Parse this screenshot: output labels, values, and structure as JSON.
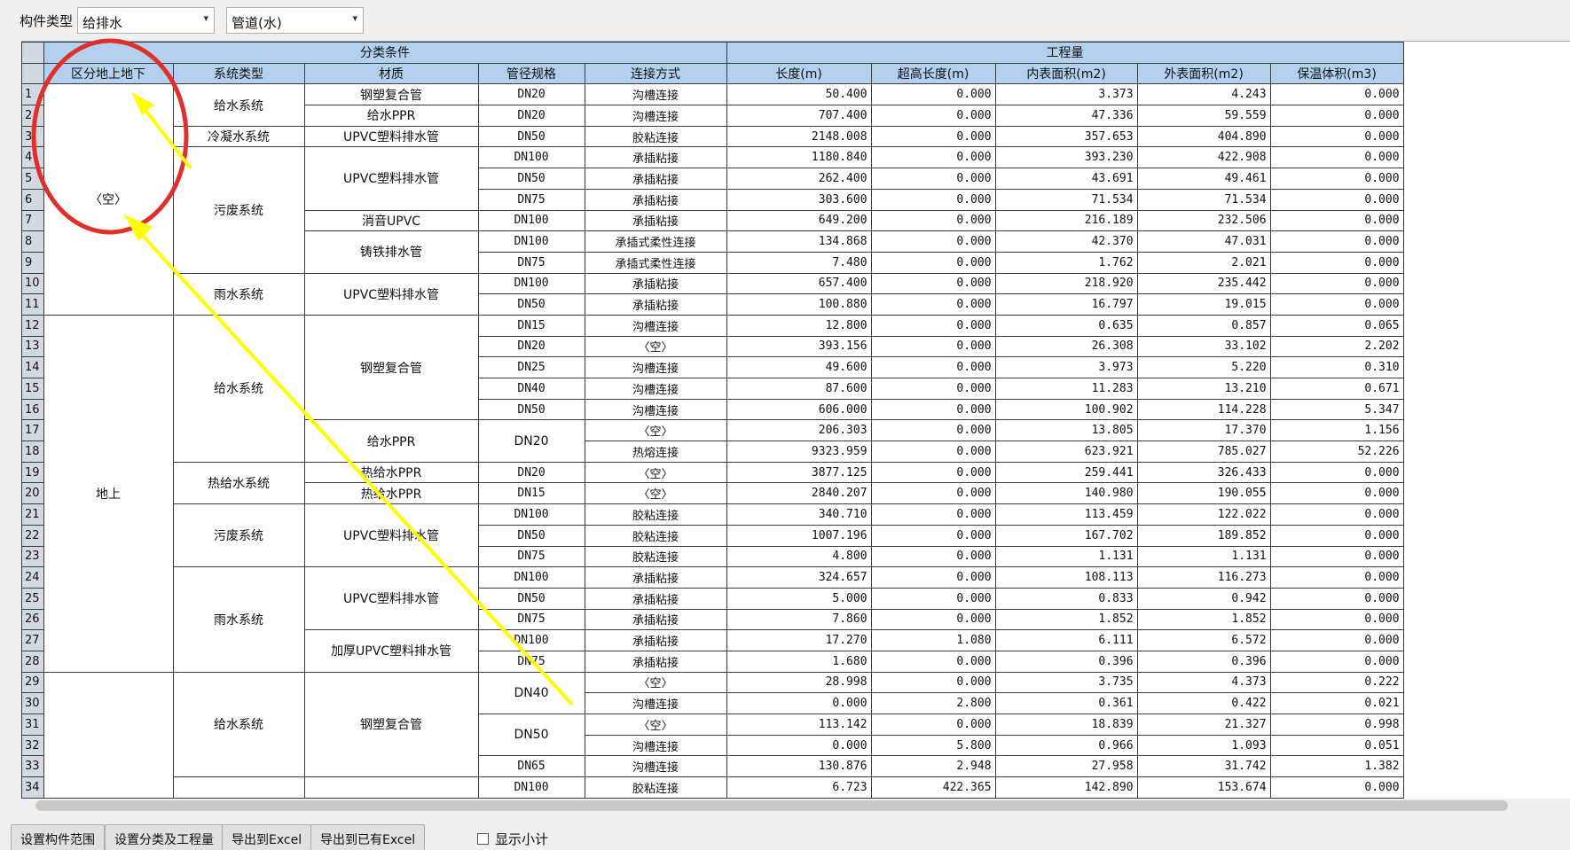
{
  "toolbar": {
    "component_type_label": "构件类型",
    "combo1": "给排水",
    "combo2": "管道(水)"
  },
  "header": {
    "group_classify": "分类条件",
    "group_quantity": "工程量",
    "columns": [
      "区分地上地下",
      "系统类型",
      "材质",
      "管径规格",
      "连接方式",
      "长度(m)",
      "超高长度(m)",
      "内表面积(m2)",
      "外表面积(m2)",
      "保温体积(m3)"
    ]
  },
  "rows": [
    {
      "n": "1",
      "g": "DN20",
      "j": "沟槽连接",
      "v": [
        "50.400",
        "0.000",
        "3.373",
        "4.243",
        "0.000"
      ]
    },
    {
      "n": "2",
      "g": "DN20",
      "j": "沟槽连接",
      "v": [
        "707.400",
        "0.000",
        "47.336",
        "59.559",
        "0.000"
      ]
    },
    {
      "n": "3",
      "g": "DN50",
      "j": "胶粘连接",
      "v": [
        "2148.008",
        "0.000",
        "357.653",
        "404.890",
        "0.000"
      ]
    },
    {
      "n": "4",
      "g": "DN100",
      "j": "承插粘接",
      "v": [
        "1180.840",
        "0.000",
        "393.230",
        "422.908",
        "0.000"
      ]
    },
    {
      "n": "5",
      "g": "DN50",
      "j": "承插粘接",
      "v": [
        "262.400",
        "0.000",
        "43.691",
        "49.461",
        "0.000"
      ]
    },
    {
      "n": "6",
      "g": "DN75",
      "j": "承插粘接",
      "v": [
        "303.600",
        "0.000",
        "71.534",
        "71.534",
        "0.000"
      ]
    },
    {
      "n": "7",
      "g": "DN100",
      "j": "承插粘接",
      "v": [
        "649.200",
        "0.000",
        "216.189",
        "232.506",
        "0.000"
      ]
    },
    {
      "n": "8",
      "g": "DN100",
      "j": "承插式柔性连接",
      "v": [
        "134.868",
        "0.000",
        "42.370",
        "47.031",
        "0.000"
      ]
    },
    {
      "n": "9",
      "g": "DN75",
      "j": "承插式柔性连接",
      "v": [
        "7.480",
        "0.000",
        "1.762",
        "2.021",
        "0.000"
      ]
    },
    {
      "n": "10",
      "g": "DN100",
      "j": "承插粘接",
      "v": [
        "657.400",
        "0.000",
        "218.920",
        "235.442",
        "0.000"
      ]
    },
    {
      "n": "11",
      "g": "DN50",
      "j": "承插粘接",
      "v": [
        "100.880",
        "0.000",
        "16.797",
        "19.015",
        "0.000"
      ]
    },
    {
      "n": "12",
      "g": "DN15",
      "j": "沟槽连接",
      "v": [
        "12.800",
        "0.000",
        "0.635",
        "0.857",
        "0.065"
      ]
    },
    {
      "n": "13",
      "g": "DN20",
      "j": "〈空〉",
      "v": [
        "393.156",
        "0.000",
        "26.308",
        "33.102",
        "2.202"
      ]
    },
    {
      "n": "14",
      "g": "DN25",
      "j": "沟槽连接",
      "v": [
        "49.600",
        "0.000",
        "3.973",
        "5.220",
        "0.310"
      ]
    },
    {
      "n": "15",
      "g": "DN40",
      "j": "沟槽连接",
      "v": [
        "87.600",
        "0.000",
        "11.283",
        "13.210",
        "0.671"
      ]
    },
    {
      "n": "16",
      "g": "DN50",
      "j": "沟槽连接",
      "v": [
        "606.000",
        "0.000",
        "100.902",
        "114.228",
        "5.347"
      ]
    },
    {
      "n": "17",
      "g": "",
      "j": "〈空〉",
      "v": [
        "206.303",
        "0.000",
        "13.805",
        "17.370",
        "1.156"
      ]
    },
    {
      "n": "18",
      "g": "",
      "j": "热熔连接",
      "v": [
        "9323.959",
        "0.000",
        "623.921",
        "785.027",
        "52.226"
      ]
    },
    {
      "n": "19",
      "g": "DN20",
      "j": "〈空〉",
      "v": [
        "3877.125",
        "0.000",
        "259.441",
        "326.433",
        "0.000"
      ]
    },
    {
      "n": "20",
      "g": "DN15",
      "j": "〈空〉",
      "v": [
        "2840.207",
        "0.000",
        "140.980",
        "190.055",
        "0.000"
      ]
    },
    {
      "n": "21",
      "g": "DN100",
      "j": "胶粘连接",
      "v": [
        "340.710",
        "0.000",
        "113.459",
        "122.022",
        "0.000"
      ]
    },
    {
      "n": "22",
      "g": "DN50",
      "j": "胶粘连接",
      "v": [
        "1007.196",
        "0.000",
        "167.702",
        "189.852",
        "0.000"
      ]
    },
    {
      "n": "23",
      "g": "DN75",
      "j": "胶粘连接",
      "v": [
        "4.800",
        "0.000",
        "1.131",
        "1.131",
        "0.000"
      ]
    },
    {
      "n": "24",
      "g": "DN100",
      "j": "承插粘接",
      "v": [
        "324.657",
        "0.000",
        "108.113",
        "116.273",
        "0.000"
      ]
    },
    {
      "n": "25",
      "g": "DN50",
      "j": "承插粘接",
      "v": [
        "5.000",
        "0.000",
        "0.833",
        "0.942",
        "0.000"
      ]
    },
    {
      "n": "26",
      "g": "DN75",
      "j": "承插粘接",
      "v": [
        "7.860",
        "0.000",
        "1.852",
        "1.852",
        "0.000"
      ]
    },
    {
      "n": "27",
      "g": "DN100",
      "j": "承插粘接",
      "v": [
        "17.270",
        "1.080",
        "6.111",
        "6.572",
        "0.000"
      ]
    },
    {
      "n": "28",
      "g": "DN75",
      "j": "承插粘接",
      "v": [
        "1.680",
        "0.000",
        "0.396",
        "0.396",
        "0.000"
      ]
    },
    {
      "n": "29",
      "g": "",
      "j": "〈空〉",
      "v": [
        "28.998",
        "0.000",
        "3.735",
        "4.373",
        "0.222"
      ]
    },
    {
      "n": "30",
      "g": "",
      "j": "沟槽连接",
      "v": [
        "0.000",
        "2.800",
        "0.361",
        "0.422",
        "0.021"
      ]
    },
    {
      "n": "31",
      "g": "",
      "j": "〈空〉",
      "v": [
        "113.142",
        "0.000",
        "18.839",
        "21.327",
        "0.998"
      ]
    },
    {
      "n": "32",
      "g": "",
      "j": "沟槽连接",
      "v": [
        "0.000",
        "5.800",
        "0.966",
        "1.093",
        "0.051"
      ]
    },
    {
      "n": "33",
      "g": "DN65",
      "j": "沟槽连接",
      "v": [
        "130.876",
        "2.948",
        "27.958",
        "31.742",
        "1.382"
      ]
    },
    {
      "n": "34",
      "g": "DN100",
      "j": "胶粘连接",
      "v": [
        "6.723",
        "422.365",
        "142.890",
        "153.674",
        "0.000"
      ]
    }
  ],
  "merged": {
    "area_empty": "〈空〉",
    "area_above": "地上",
    "sys_water": "给水系统",
    "sys_condense": "冷凝水系统",
    "sys_waste": "污废系统",
    "sys_rain": "雨水系统",
    "sys_hot": "热给水系统",
    "mat_steel": "钢塑复合管",
    "mat_ppr": "给水PPR",
    "mat_upvc": "UPVC塑料排水管",
    "mat_muffler": "消音UPVC",
    "mat_iron": "铸铁排水管",
    "mat_hotppr": "热给水PPR",
    "mat_thick": "加厚UPVC塑料排水管",
    "size_dn20": "DN20",
    "size_dn40": "DN40",
    "size_dn50": "DN50"
  },
  "buttons": {
    "set_range": "设置构件范围",
    "set_classify": "设置分类及工程量",
    "export_excel": "导出到Excel",
    "export_existing": "导出到已有Excel",
    "show_subtotal": "显示小计"
  },
  "colors": {
    "header_bg": "#b3d0ef",
    "annotation_circle": "#e0302a",
    "annotation_arrow": "#ffff00"
  }
}
